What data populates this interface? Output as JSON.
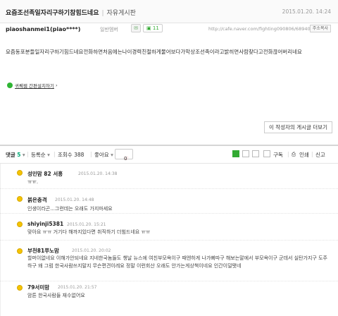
{
  "post": {
    "title": "요즘조선족일자리구하기참힘드네요",
    "board": "자유게시판",
    "date": "2015.01.20. 14:24",
    "author": "piaoshanmei1(piao****)",
    "member_level": "일반멤버",
    "comment_badge": "11",
    "url": "http://cafe.naver.com/fighting090806/68940",
    "copy_label": "주소복사",
    "body": "요즘동포분들일자리구하기힘드네요전화하면처음에는나이경력친절하게물어보다가막상조선족이라고밝히면사람찾다고전화끊어버리네요",
    "gi_label": "귀퀘웹 간편설치하기",
    "more_posts": "이 작성자의 게시글 더보기"
  },
  "actions": {
    "comment_label": "댓글",
    "comment_count": "5",
    "sort_label": "등록순",
    "views_label": "조회수",
    "views_count": "388",
    "like_label": "좋아요",
    "like_count": "0",
    "subscribe_label": "구독",
    "print_label": "인쇄",
    "report_label": "신고"
  },
  "comments": [
    {
      "nick": "성민맘 82 서흥",
      "date": "2015.01.20. 14:38",
      "text": "ㅠㅠ."
    },
    {
      "nick": "붉은충격",
      "date": "2015.01.20. 14:48",
      "text": "인생이라곤...그런데는 오래도 가지마세요"
    },
    {
      "nick": "shiyinji5381",
      "date": "2015.01.20. 15:21",
      "text": "맞아요 ㅠㅠ 거기다 해까지있다면 취직하기 더힘드네요 ㅠㅠ"
    },
    {
      "nick": "부천81쭈노맘",
      "date": "2015.01.20. 20:02",
      "text": "할머이없네요 이해가안되네요 지네한국놈들도 챙날 뉴스에 여친부모욕이구 때엔하게 나가뻐따구 해보는말에서 부모욕이구 군데서 실탄가지구 도주하구 왜 그럼 한국사람쓰지말지 무슨편견이레요 정말 이런회산 오래도 안가는게상책이네요 인간이덜됏네"
    },
    {
      "nick": "79서미맘",
      "date": "2015.01.20. 21:57",
      "text": "암튼 한국사람들 재수없어요"
    }
  ],
  "colors": {
    "accent": "#00aa77",
    "avatar": "#f5c400"
  }
}
